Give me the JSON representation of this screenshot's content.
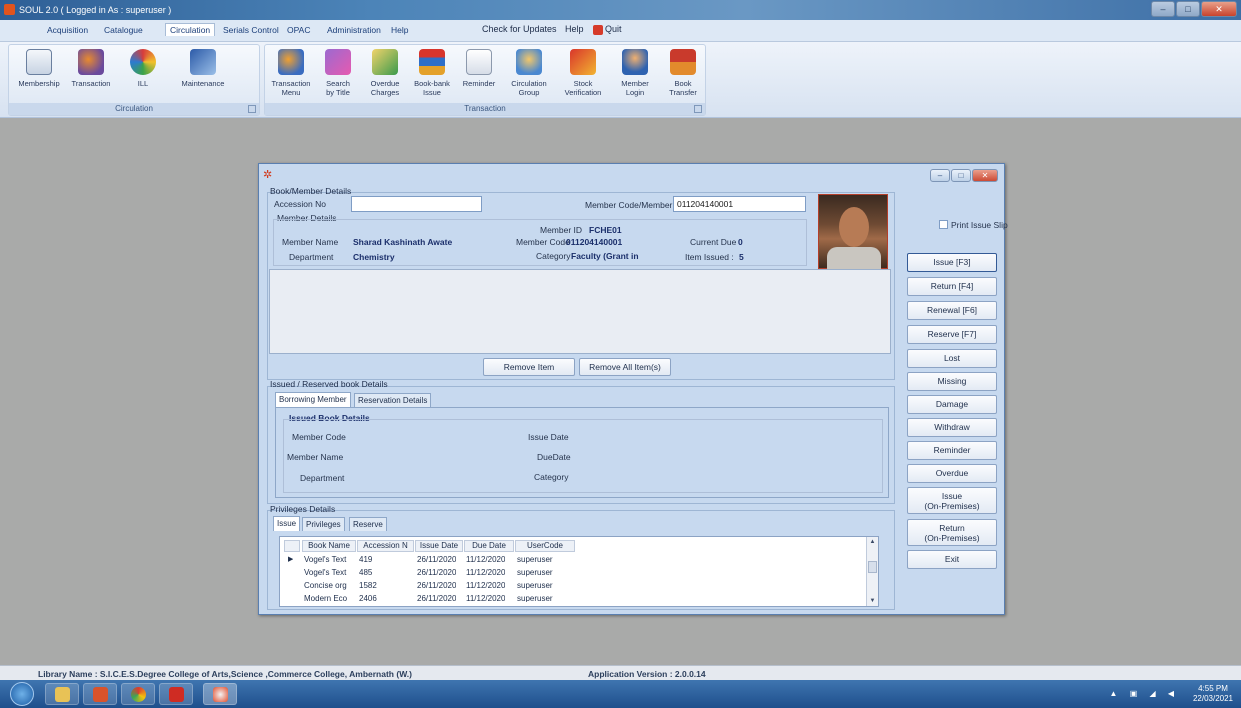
{
  "window": {
    "title": "SOUL 2.0  ( Logged in As : superuser )"
  },
  "menu": {
    "items": [
      "Acquisition",
      "Catalogue",
      "Circulation",
      "Serials Control",
      "OPAC",
      "Administration",
      "Help"
    ],
    "active": "Circulation",
    "check_updates": "Check for Updates",
    "help": "Help",
    "quit": "Quit"
  },
  "ribbon": {
    "circulation_group": {
      "name": "Circulation",
      "buttons": [
        {
          "label": "Membership",
          "icon": "membership-card-icon"
        },
        {
          "label": "Transaction",
          "icon": "transaction-people-icon"
        },
        {
          "label": "ILL",
          "icon": "ill-icon"
        },
        {
          "label": "Maintenance",
          "icon": "maintenance-icon"
        }
      ]
    },
    "transaction_group": {
      "name": "Transaction",
      "buttons": [
        {
          "label": "Transaction\nMenu",
          "icon": "transaction-menu-icon"
        },
        {
          "label": "Search\nby Title",
          "icon": "search-by-title-icon"
        },
        {
          "label": "Overdue\nCharges",
          "icon": "overdue-charges-icon"
        },
        {
          "label": "Book-bank\nIssue",
          "icon": "book-bank-icon"
        },
        {
          "label": "Reminder",
          "icon": "reminder-icon"
        },
        {
          "label": "Circulation\nGroup",
          "icon": "circulation-group-icon"
        },
        {
          "label": "Stock\nVerification",
          "icon": "stock-verification-icon"
        },
        {
          "label": "Member\nLogin",
          "icon": "member-login-icon"
        },
        {
          "label": "Book\nTransfer",
          "icon": "book-transfer-icon"
        }
      ]
    }
  },
  "dialog": {
    "book_member_title": "Book/Member Details",
    "accession_label": "Accession No",
    "accession_value": "",
    "member_code_label": "Member Code/Member ID",
    "member_code_value": "011204140001",
    "member_details_title": "Member Details",
    "member_id_label": "Member ID",
    "member_id_value": "FCHE01",
    "member_name_label": "Member Name",
    "member_name_value": "Sharad Kashinath Awate",
    "member_code2_label": "Member Code",
    "member_code2_value": "011204140001",
    "current_due_label": "Current Due",
    "current_due_value": "0",
    "department_label": "Department",
    "department_value": "Chemistry",
    "category_label": "Category",
    "category_value": "Faculty (Grant in",
    "items_issued_label": "Item Issued :",
    "items_issued_value": "5",
    "print_issue_slip": "Print Issue Slip",
    "remove_item": "Remove Item",
    "remove_all": "Remove All Item(s)",
    "issued_reserved_title": "Issued / Reserved book Details",
    "tabs_top": [
      "Borrowing Member",
      "Reservation Details"
    ],
    "issued_book_title": "Issued Book Details",
    "ib_member_code": "Member Code",
    "ib_member_name": "Member Name",
    "ib_department": "Department",
    "ib_issue_date": "Issue Date",
    "ib_due_date": "DueDate",
    "ib_category": "Category",
    "privileges_title": "Privileges Details",
    "tabs_bottom": [
      "Issue",
      "Privileges",
      "Reserve"
    ],
    "grid": {
      "columns": [
        "Book Name",
        "Accession N",
        "Issue Date",
        "Due Date",
        "UserCode"
      ],
      "rows": [
        [
          "Vogel's Text",
          "419",
          "26/11/2020",
          "11/12/2020",
          "superuser"
        ],
        [
          "Vogel's Text",
          "485",
          "26/11/2020",
          "11/12/2020",
          "superuser"
        ],
        [
          "Concise org",
          "1582",
          "26/11/2020",
          "11/12/2020",
          "superuser"
        ],
        [
          "Modern Eco",
          "2406",
          "26/11/2020",
          "11/12/2020",
          "superuser"
        ]
      ]
    },
    "side_buttons": [
      "Issue [F3]",
      "Return [F4]",
      "Renewal [F6]",
      "Reserve [F7]",
      "Lost",
      "Missing",
      "Damage",
      "Withdraw",
      "Reminder",
      "Overdue",
      "Issue\n(On-Premises)",
      "Return\n(On-Premises)",
      "Exit"
    ]
  },
  "status": {
    "library_name": "Library Name : S.I.C.E.S.Degree College of Arts,Science ,Commerce College,  Ambernath (W.)",
    "app_version": "Application Version : 2.0.0.14"
  },
  "taskbar": {
    "time": "4:55 PM",
    "date": "22/03/2021"
  },
  "colors": {
    "accent": "#1c3f7a",
    "dialog_bg": "#c7d9ef",
    "workspace": "#a9aaa9",
    "taskbar": "#2a5f9e"
  }
}
